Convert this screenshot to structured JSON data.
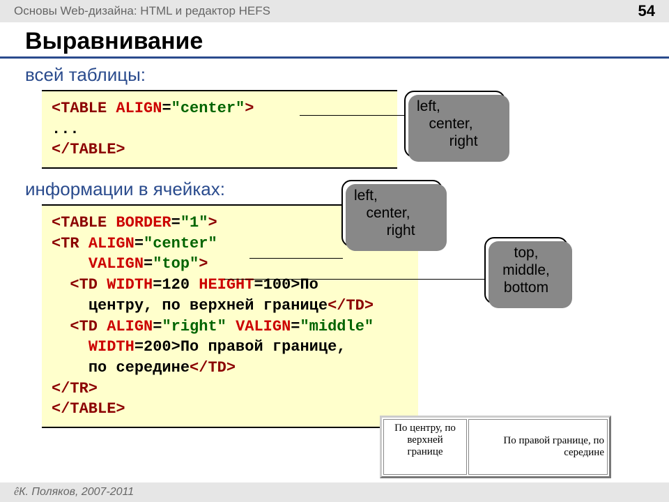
{
  "header": {
    "course": "Основы Web-дизайна: HTML и редактор HEFS",
    "page": "54"
  },
  "title": "Выравнивание",
  "sub1": "всей таблицы:",
  "sub2": "информации в ячейках:",
  "code1": {
    "t_open": "<TABLE",
    "sp1": " ",
    "attr_align": "ALIGN",
    "eq1": "=",
    "val_center": "\"center\"",
    "gt1": ">",
    "dots": "...",
    "t_close": "</TABLE>"
  },
  "code2": {
    "l1a": "<TABLE",
    "l1b": " ",
    "l1c": "BORDER",
    "l1d": "=",
    "l1e": "\"1\"",
    "l1f": ">",
    "l2a": "<TR",
    "l2b": " ",
    "l2c": "ALIGN",
    "l2d": "=",
    "l2e": "\"center\"",
    "l3pad": "    ",
    "l3a": "VALIGN",
    "l3b": "=",
    "l3c": "\"top\"",
    "l3d": ">",
    "l4pad": "  ",
    "l4a": "<TD",
    "l4b": " ",
    "l4c": "WIDTH",
    "l4d": "=120 ",
    "l4e": "HEIGHT",
    "l4f": "=100>",
    "l4g": "По",
    "l5pad": "    ",
    "l5a": "центру, по верхней границе",
    "l5b": "</TD>",
    "l6pad": "  ",
    "l6a": "<TD",
    "l6b": " ",
    "l6c": "ALIGN",
    "l6d": "=",
    "l6e": "\"right\"",
    "l6f": " ",
    "l6g": "VALIGN",
    "l6h": "=",
    "l6i": "\"middle\"",
    "l7pad": "    ",
    "l7a": "WIDTH",
    "l7b": "=200>",
    "l7c": "По правой границе,",
    "l8pad": "    ",
    "l8a": "по середине",
    "l8b": "</TD>",
    "l9": "</TR>",
    "l10": "</TABLE>"
  },
  "callout1": {
    "l1": "left,",
    "l2": "   center,",
    "l3": "        right"
  },
  "callout2": {
    "l1": "left,",
    "l2": "   center,",
    "l3": "        right"
  },
  "callout3": {
    "l1": " top,",
    "l2": "middle,",
    "l3": "bottom"
  },
  "demo": {
    "c1": "По центру, по\nверхней\nгранице",
    "c2": "По правой границе, по\nсередине"
  },
  "footer": {
    "sym": "ê",
    "author": " К. Поляков, 2007-2011"
  }
}
